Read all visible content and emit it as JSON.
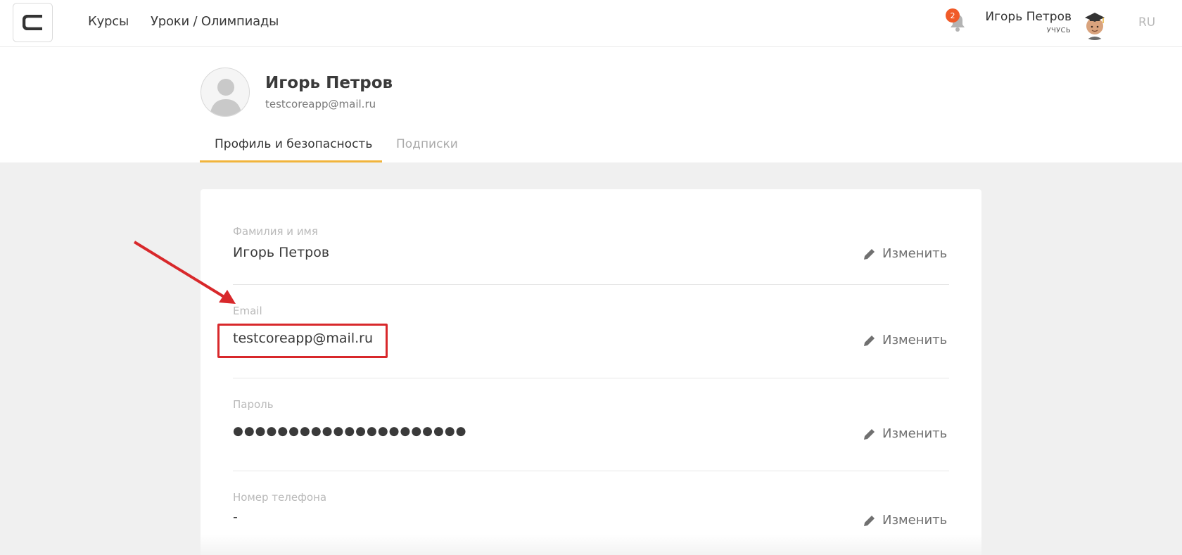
{
  "topbar": {
    "logo_icon": "c-logo-icon",
    "nav": [
      {
        "label": "Курсы"
      },
      {
        "label": "Уроки / Олимпиады"
      }
    ],
    "notifications": {
      "count": "2",
      "icon": "bell-icon",
      "badge_color": "#f05a28"
    },
    "user": {
      "name": "Игорь Петров",
      "role": "УЧУСЬ",
      "avatar": "student-avatar-icon"
    },
    "language": "RU"
  },
  "profile": {
    "name": "Игорь Петров",
    "email": "testcoreapp@mail.ru",
    "avatar": "default-user-avatar-icon",
    "tabs": [
      {
        "label": "Профиль и безопасность",
        "active": true
      },
      {
        "label": "Подписки",
        "active": false
      }
    ],
    "accent_color": "#f1b43c"
  },
  "fields": [
    {
      "label": "Фамилия и имя",
      "value": "Игорь Петров",
      "edit_label": "Изменить"
    },
    {
      "label": "Email",
      "value": "testcoreapp@mail.ru",
      "edit_label": "Изменить"
    },
    {
      "label": "Пароль",
      "value": "●●●●●●●●●●●●●●●●●●●●●",
      "edit_label": "Изменить"
    },
    {
      "label": "Номер телефона",
      "value": "-",
      "edit_label": "Изменить"
    }
  ],
  "annotation": {
    "highlight_color": "#d8282b",
    "highlighted_field": "Email"
  }
}
